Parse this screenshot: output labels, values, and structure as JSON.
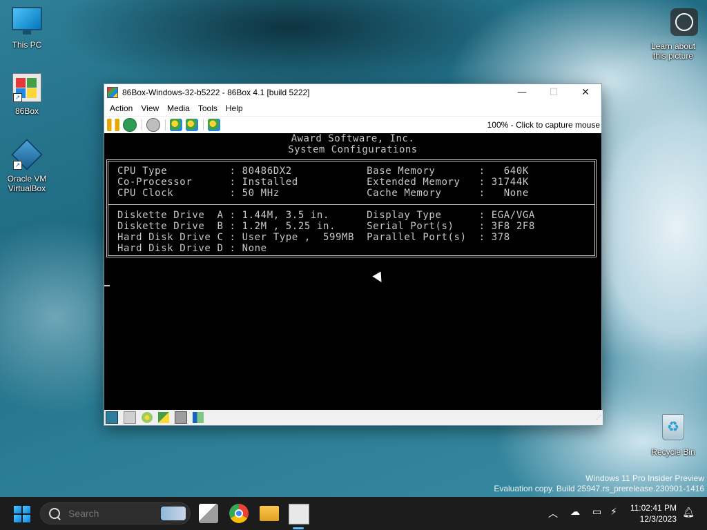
{
  "desktop": {
    "icons": [
      {
        "label": "This PC"
      },
      {
        "label": "86Box"
      },
      {
        "label": "Oracle VM VirtualBox"
      },
      {
        "label": "Learn about this picture"
      },
      {
        "label": "Recycle Bin"
      }
    ]
  },
  "window": {
    "title": "86Box-Windows-32-b5222 - 86Box 4.1 [build 5222]",
    "controls": {
      "minimize": "—",
      "maximize": "☐",
      "close": "✕"
    },
    "menu": [
      "Action",
      "View",
      "Media",
      "Tools",
      "Help"
    ],
    "status_text": "100% - Click to capture mouse"
  },
  "bios": {
    "header": [
      "Award Software, Inc.",
      "System Configurations"
    ],
    "rows_top": [
      "CPU Type          : 80486DX2            Base Memory       :   640K",
      "Co-Processor      : Installed           Extended Memory   : 31744K",
      "CPU Clock         : 50 MHz              Cache Memory      :   None"
    ],
    "rows_bottom": [
      "Diskette Drive  A : 1.44M, 3.5 in.      Display Type      : EGA/VGA",
      "Diskette Drive  B : 1.2M , 5.25 in.     Serial Port(s)    : 3F8 2F8",
      "Hard Disk Drive C : User Type ,  599MB  Parallel Port(s)  : 378",
      "Hard Disk Drive D : None"
    ]
  },
  "watermark": {
    "line1": "Windows 11 Pro Insider Preview",
    "line2": "Evaluation copy. Build 25947.rs_prerelease.230901-1416"
  },
  "taskbar": {
    "search_placeholder": "Search",
    "time": "11:02:41 PM",
    "date": "12/3/2023"
  }
}
